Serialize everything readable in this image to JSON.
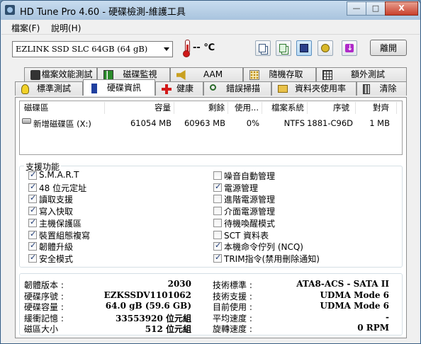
{
  "window": {
    "title": "HD Tune Pro 4.60 - 硬碟檢測-維護工具",
    "min": "—",
    "max": "□",
    "close": "X"
  },
  "menu": [
    "檔案(F)",
    "說明(H)"
  ],
  "toolbar": {
    "drive": "EZLINK  SSD SLC 64GB    (64 gB)",
    "temperature": "-- ℃",
    "exit": "離開"
  },
  "tabs_row1": [
    "檔案效能測試",
    "磁碟監視",
    "AAM",
    "隨機存取",
    "額外測試"
  ],
  "tabs_row2": [
    "標準測試",
    "硬碟資訊",
    "健康",
    "錯誤掃描",
    "資料夾使用率",
    "清除"
  ],
  "active_tab": "硬碟資訊",
  "volume_table": {
    "headers": [
      "磁碟區",
      "容量",
      "剩餘",
      "使用...",
      "檔案系統",
      "序號",
      "對齊"
    ],
    "rows": [
      [
        "新增磁碟區 (X:)",
        "61054 MB",
        "60963 MB",
        "0%",
        "NTFS",
        "1881-C96D",
        "1 MB"
      ]
    ]
  },
  "features": {
    "title": "支援功能",
    "left": [
      {
        "label": "S.M.A.R.T",
        "checked": true
      },
      {
        "label": "48 位元定址",
        "checked": true
      },
      {
        "label": "讀取支援",
        "checked": true
      },
      {
        "label": "寫入快取",
        "checked": true
      },
      {
        "label": "主機保護區",
        "checked": true
      },
      {
        "label": "裝置組態複寫",
        "checked": true
      },
      {
        "label": "韌體升級",
        "checked": true
      },
      {
        "label": "安全模式",
        "checked": true
      }
    ],
    "right": [
      {
        "label": "噪音自動管理",
        "checked": false
      },
      {
        "label": "電源管理",
        "checked": true
      },
      {
        "label": "進階電源管理",
        "checked": false
      },
      {
        "label": "介面電源管理",
        "checked": false
      },
      {
        "label": "待機喚醒模式",
        "checked": false
      },
      {
        "label": "SCT 資料表",
        "checked": false
      },
      {
        "label": "本機命令佇列 (NCQ)",
        "checked": true
      },
      {
        "label": "TRIM指令(禁用刪除通知)",
        "checked": true
      }
    ]
  },
  "info_left": [
    {
      "key": "韌體版本 :",
      "value": "2030"
    },
    {
      "key": "硬碟序號 :",
      "value": "EZKSSDV1101062"
    },
    {
      "key": "硬碟容量 :",
      "value": "64.0 gB (59.6 GB)"
    },
    {
      "key": "緩衝記憶 :",
      "value": "33553920 位元組"
    },
    {
      "key": "磁區大小",
      "value": "512 位元組"
    }
  ],
  "info_right": [
    {
      "key": "技術標準 :",
      "value": "ATA8-ACS - SATA II"
    },
    {
      "key": "技術支援 :",
      "value": "UDMA Mode 6"
    },
    {
      "key": "目前使用 :",
      "value": "UDMA Mode 6"
    },
    {
      "key": "平均速度 :",
      "value": "-"
    },
    {
      "key": "旋轉速度 :",
      "value": "0 RPM"
    }
  ]
}
